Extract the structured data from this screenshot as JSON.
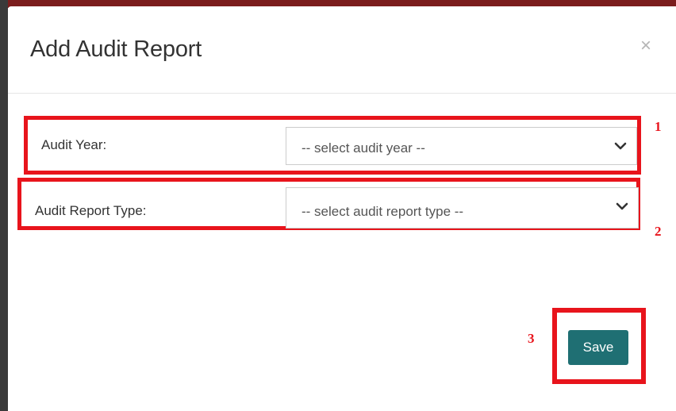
{
  "modal": {
    "title": "Add Audit Report",
    "close_glyph": "×"
  },
  "form": {
    "audit_year": {
      "label": "Audit Year:",
      "selected": "-- select audit year --"
    },
    "audit_report_type": {
      "label": "Audit Report Type:",
      "selected": "-- select audit report type --"
    }
  },
  "actions": {
    "save_label": "Save"
  },
  "annotations": {
    "marker_1": "1",
    "marker_2": "2",
    "marker_3": "3"
  },
  "colors": {
    "annotation_red": "#e8141c",
    "save_button": "#1f6f73"
  }
}
